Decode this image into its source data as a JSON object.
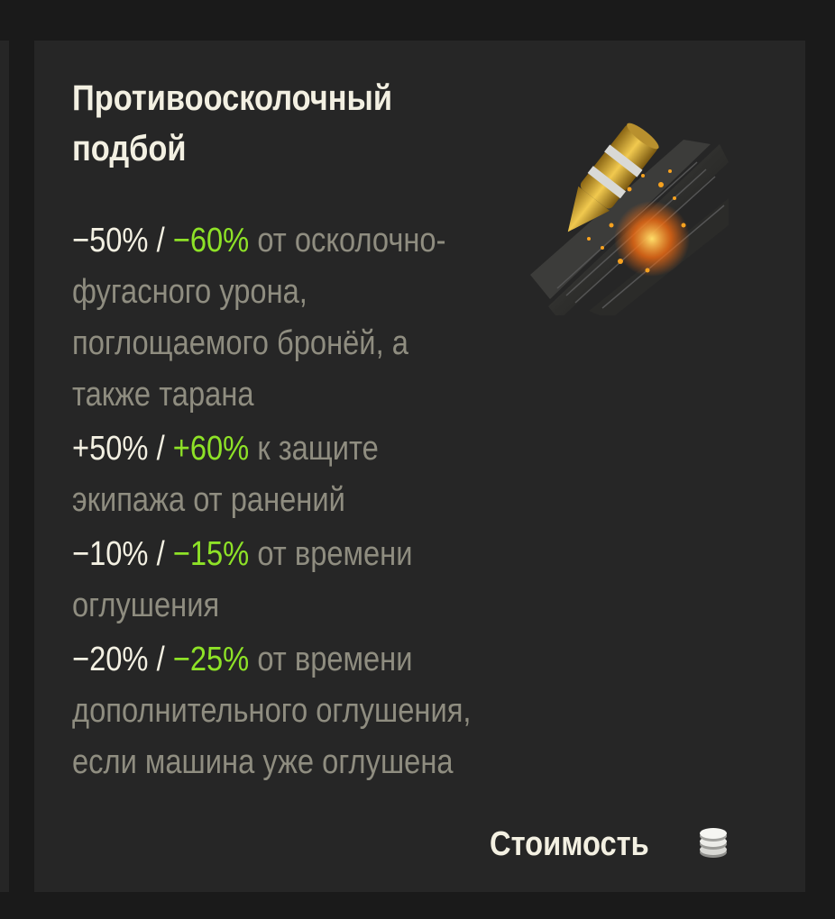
{
  "equipment": {
    "title": "Противоосколочный подбой",
    "icon": "spall-liner-icon",
    "effects": [
      {
        "base": "−50% /",
        "bonus": "−60%",
        "text": "от осколочно-фугасного урона, поглощаемого бронёй, а также тарана"
      },
      {
        "base": "+50% /",
        "bonus": "+60%",
        "text": "к защите экипажа от ранений"
      },
      {
        "base": "−10% /",
        "bonus": "−15%",
        "text": "от времени оглушения"
      },
      {
        "base": "−20% /",
        "bonus": "−25%",
        "text": "от времени дополнительного оглушения, если машина уже оглушена"
      }
    ],
    "cost_label": "Стоимость",
    "cost_icon": "silver-coins-icon"
  },
  "colors": {
    "background": "#1a1a1a",
    "panel": "#262626",
    "text_primary": "#f3f0e2",
    "text_secondary": "#8f8d80",
    "bonus_green": "#8ee227"
  }
}
